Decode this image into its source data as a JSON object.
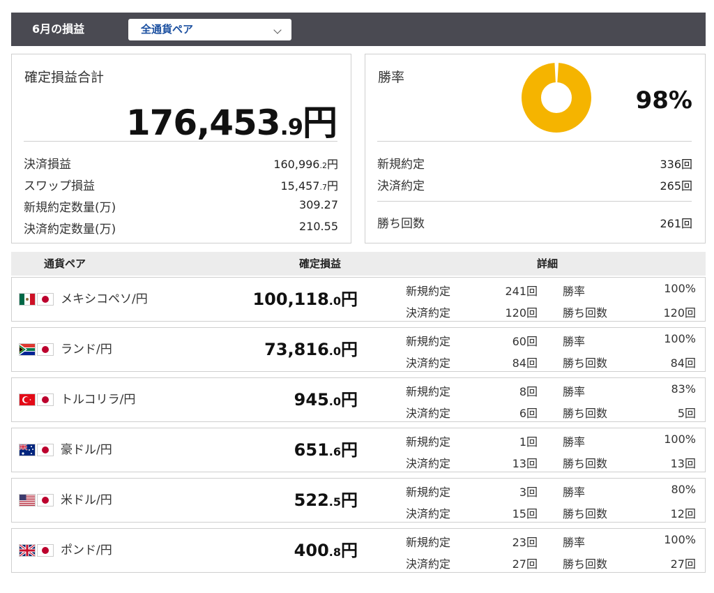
{
  "header": {
    "title": "6月の損益",
    "pair_select": {
      "value": "全通貨ペア"
    }
  },
  "summary": {
    "label": "確定損益合計",
    "total_int": "176,453",
    "total_dec": ".9",
    "total_unit": "円",
    "items": [
      {
        "label": "決済損益",
        "int": "160,996",
        "dec": ".2",
        "unit": "円"
      },
      {
        "label": "スワップ損益",
        "int": "15,457",
        "dec": ".7",
        "unit": "円"
      },
      {
        "label": "新規約定数量(万)",
        "int": "309.27",
        "dec": "",
        "unit": ""
      },
      {
        "label": "決済約定数量(万)",
        "int": "210.55",
        "dec": "",
        "unit": ""
      }
    ]
  },
  "winrate": {
    "label": "勝率",
    "percent": "98%",
    "percent_value": 98,
    "donut_color": "#f5b400",
    "items": [
      {
        "label": "新規約定",
        "value": "336回"
      },
      {
        "label": "決済約定",
        "value": "265回"
      },
      {
        "label": "勝ち回数",
        "value": "261回"
      }
    ]
  },
  "table": {
    "headers": {
      "pair": "通貨ペア",
      "profit": "確定損益",
      "detail": "詳細"
    },
    "detail_labels": {
      "new": "新規約定",
      "settle": "決済約定",
      "rate": "勝率",
      "wins": "勝ち回数"
    },
    "rows": [
      {
        "flag": "mexico-flag-icon",
        "pair": "メキシコペソ/円",
        "profit_int": "100,118",
        "profit_dec": ".0",
        "profit_unit": "円",
        "new": "241回",
        "settle": "120回",
        "rate": "100%",
        "wins": "120回"
      },
      {
        "flag": "south-africa-flag-icon",
        "pair": "ランド/円",
        "profit_int": "73,816",
        "profit_dec": ".0",
        "profit_unit": "円",
        "new": "60回",
        "settle": "84回",
        "rate": "100%",
        "wins": "84回"
      },
      {
        "flag": "turkey-flag-icon",
        "pair": "トルコリラ/円",
        "profit_int": "945",
        "profit_dec": ".0",
        "profit_unit": "円",
        "new": "8回",
        "settle": "6回",
        "rate": "83%",
        "wins": "5回"
      },
      {
        "flag": "australia-flag-icon",
        "pair": "豪ドル/円",
        "profit_int": "651",
        "profit_dec": ".6",
        "profit_unit": "円",
        "new": "1回",
        "settle": "13回",
        "rate": "100%",
        "wins": "13回"
      },
      {
        "flag": "usa-flag-icon",
        "pair": "米ドル/円",
        "profit_int": "522",
        "profit_dec": ".5",
        "profit_unit": "円",
        "new": "3回",
        "settle": "15回",
        "rate": "80%",
        "wins": "12回"
      },
      {
        "flag": "uk-flag-icon",
        "pair": "ポンド/円",
        "profit_int": "400",
        "profit_dec": ".8",
        "profit_unit": "円",
        "new": "23回",
        "settle": "27回",
        "rate": "100%",
        "wins": "27回"
      }
    ]
  }
}
